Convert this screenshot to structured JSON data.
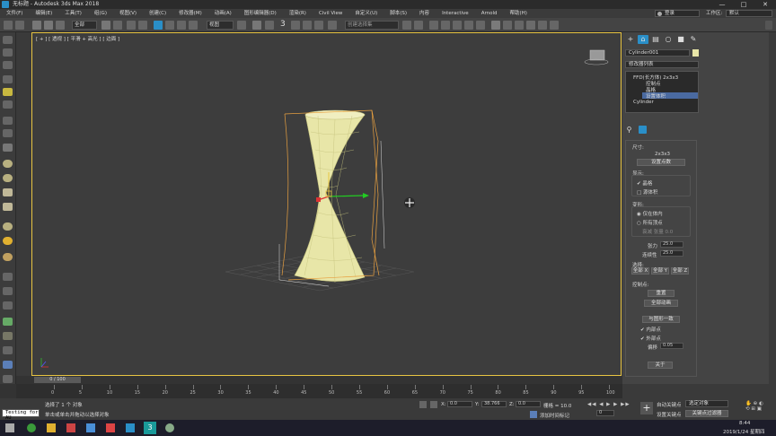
{
  "window": {
    "title": "无标题 - Autodesk 3ds Max 2018",
    "min": "—",
    "max": "□",
    "close": "✕"
  },
  "menu": {
    "items": [
      "文件(F)",
      "编辑(E)",
      "工具(T)",
      "组(G)",
      "视图(V)",
      "创建(C)",
      "修改器(M)",
      "动画(A)",
      "图形编辑器(D)",
      "渲染(R)",
      "Civil View",
      "自定义(U)",
      "脚本(S)",
      "内容",
      "Interactive",
      "Arnold",
      "帮助(H)"
    ],
    "signin": "登录",
    "workspace_label": "工作区:",
    "workspace_value": "默认"
  },
  "toolbar": {
    "filter": "全部",
    "view": "视图",
    "num3": "3",
    "selection_set": "创建选择集"
  },
  "viewport": {
    "label": "[ + ] [ 透视 ] [ 平滑 + 高光 ] [ 边面 ]"
  },
  "panel": {
    "object_name": "Cylinder001",
    "modifier_list": "修改器列表",
    "stack": [
      "FFD(长方体) 2x3x3",
      "控制点",
      "晶格",
      "设置体积",
      "Cylinder"
    ],
    "dims_title": "尺寸:",
    "dims_value": "2x3x3",
    "set_points": "设置点数",
    "display_title": "显示:",
    "lattice": "晶格",
    "source_volume": "源体积",
    "deform_title": "变形:",
    "only_in_volume": "仅在体内",
    "all_vertices": "所有顶点",
    "falloff": "衰减  张量 0.0",
    "tension_label": "张力",
    "tension_value": "25.0",
    "continuity_label": "连续性",
    "continuity_value": "25.0",
    "selection_title": "选择:",
    "sel_x": "全部 X",
    "sel_y": "全部 Y",
    "sel_z": "全部 Z",
    "cp_title": "控制点:",
    "reset": "重置",
    "animate_all": "全部动画",
    "conform": "与图形一致",
    "inside_points": "内部点",
    "outside_points": "外部点",
    "offset_label": "偏移",
    "offset_value": "0.05",
    "about": "关于"
  },
  "timeline": {
    "slider": "0 / 100",
    "ticks": [
      "0",
      "5",
      "10",
      "15",
      "20",
      "25",
      "30",
      "35",
      "40",
      "45",
      "50",
      "55",
      "60",
      "65",
      "70",
      "75",
      "80",
      "85",
      "90",
      "95",
      "100"
    ]
  },
  "status": {
    "script_field": "Testing for AU",
    "selected": "选择了 1 个 对象",
    "hint": "单击或单击并拖动以选择对象",
    "x_label": "X:",
    "x_value": "0.0",
    "y_label": "Y:",
    "y_value": "38.766",
    "z_label": "Z:",
    "z_value": "0.0",
    "grid": "栅格 = 10.0",
    "add_time_tag": "添加时间标记",
    "auto_key": "自动关键点",
    "selected_obj": "选定对象",
    "set_key": "设置关键点",
    "key_filters": "关键点过滤器",
    "frame": "0"
  },
  "taskbar": {
    "time": "8:44",
    "date": "2019/1/24 星期四"
  },
  "colors": {
    "accent_blue": "#2a8fc8",
    "selection_yellow": "#e9c542",
    "object_fill": "#e8e6a8",
    "panel_bg": "#444444"
  }
}
